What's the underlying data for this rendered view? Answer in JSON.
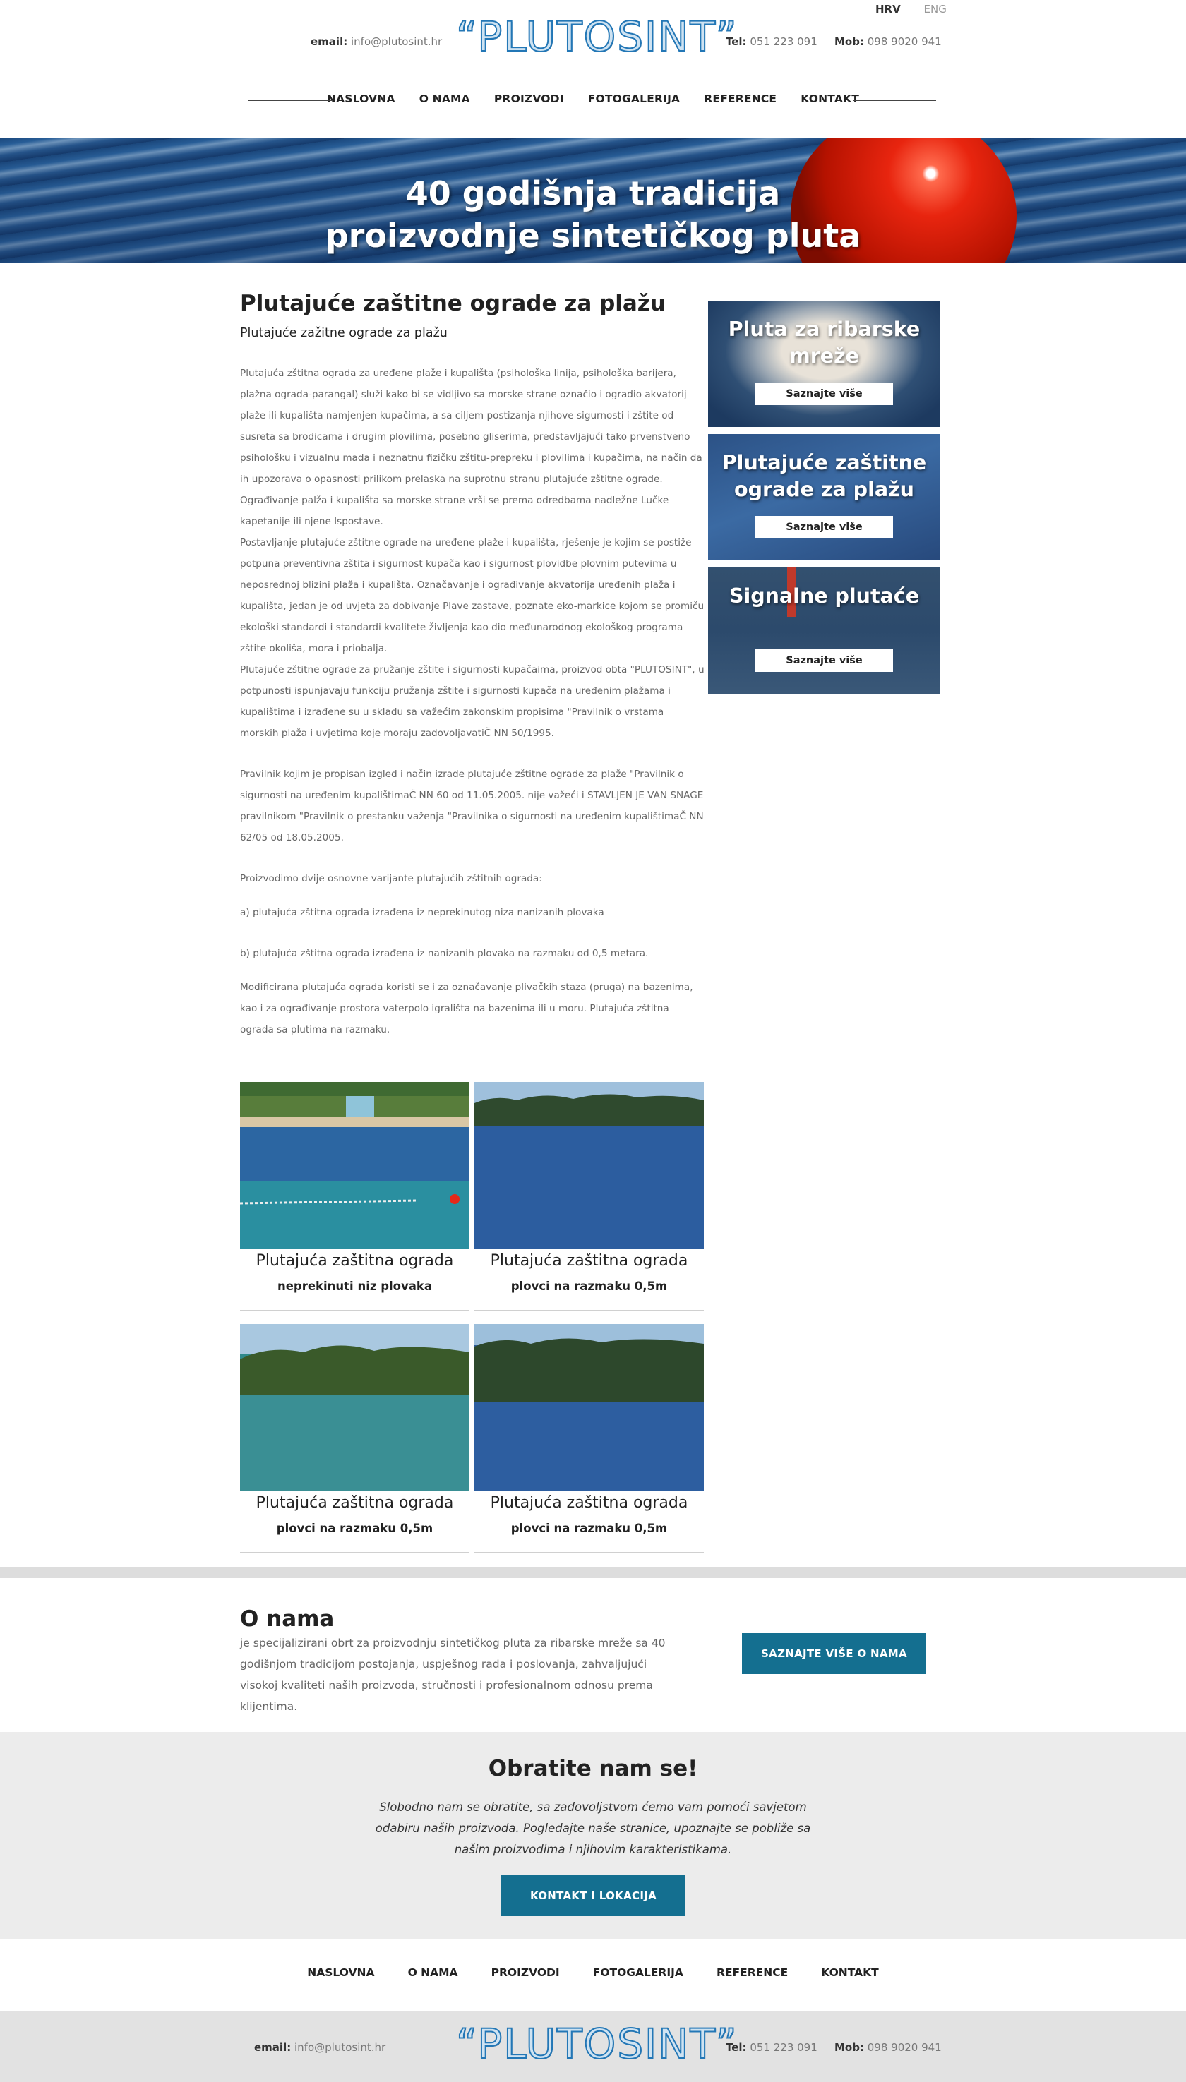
{
  "header": {
    "languages": [
      {
        "label": "HRV",
        "active": true
      },
      {
        "label": "ENG",
        "active": false
      }
    ],
    "email_label": "email:",
    "email": "info@plutosint.hr",
    "logo_text": "“PLUTOSINT”",
    "tel_label": "Tel:",
    "tel": "051 223 091",
    "mob_label": "Mob:",
    "mob": "098 9020 941"
  },
  "nav": {
    "items": [
      "NASLOVNA",
      "O NAMA",
      "PROIZVODI",
      "FOTOGALERIJA",
      "REFERENCE",
      "KONTAKT"
    ]
  },
  "hero": {
    "line1": "40 godišnja tradicija",
    "line2": "proizvodnje sintetičkog pluta"
  },
  "main": {
    "title": "Plutajuće zaštitne ograde za plažu",
    "subtitle": "Plutajuće zažitne ograde za plažu",
    "para1": "Plutajuća zštitna ograda za uređene plaže i kupališta (psihološka linija, psihološka barijera, plažna ograda-parangal) služi kako bi se vidljivo sa morske strane označio i ogradio akvatorij plaže ili kupališta namjenjen kupačima, a sa ciljem postizanja njihove sigurnosti i zštite od susreta sa brodicama i drugim plovilima, posebno gliserima, predstavljajući tako prvenstveno psihološku i vizualnu mada i neznatnu fizičku zštitu-prepreku i plovilima i kupačima, na način da ih upozorava o opasnosti prilikom prelaska na suprotnu stranu plutajuće zštitne ograde. Ograđivanje palža i kupališta sa morske strane vrši se prema odredbama nadležne Lučke kapetanije ili njene Ispostave.",
    "para2": "Postavljanje plutajuće zštitne ograde na uređene plaže i kupališta, rješenje je kojim se postiže potpuna preventivna zštita i sigurnost kupača kao i sigurnost plovidbe plovnim putevima u neposrednoj blizini plaža i kupališta. Označavanje i ograđivanje akvatorija uređenih plaža i kupališta, jedan je od uvjeta za dobivanje Plave zastave, poznate eko-markice kojom se promiču ekološki standardi i standardi kvalitete življenja kao dio međunarodnog ekološkog programa zštite okoliša, mora i priobalja.",
    "para3": "Plutajuće zštitne ograde za pružanje zštite i sigurnosti kupačaima, proizvod obta \"PLUTOSINT\", u potpunosti ispunjavaju funkciju pružanja zštite i sigurnosti kupača na uređenim plažama i kupalištima i izrađene su u skladu sa važećim zakonskim propisima \"Pravilnik o vrstama morskih plaža i uvjetima koje moraju zadovoljavatiČ NN 50/1995.",
    "para4": "Pravilnik kojim je propisan izgled i način izrade plutajuće zštitne ograde za plaže \"Pravilnik o sigurnosti na uređenim kupalištimaČ NN 60 od 11.05.2005. nije važeći i STAVLJEN JE VAN SNAGE pravilnikom \"Pravilnik o prestanku važenja \"Pravilnika o sigurnosti na uređenim kupalištimaČ NN 62/05 od 18.05.2005.",
    "para5": "Proizvodimo dvije osnovne varijante plutajućih zštitnih ograda:",
    "para6": "a) plutajuća zštitna ograda izrađena iz neprekinutog niza nanizanih plovaka",
    "para7": "b) plutajuća zštitna ograda izrađena iz nanizanih plovaka na razmaku od 0,5 metara.",
    "para8": "Modificirana plutajuća ograda koristi se i za označavanje plivačkih staza (pruga) na bazenima, kao i za ograđivanje prostora vaterpolo igrališta na bazenima ili u moru. Plutajuća zštitna ograda sa plutima na razmaku."
  },
  "gallery": [
    {
      "caption": "Plutajuća zaštitna ograda",
      "subcaption": "neprekinuti niz plovaka"
    },
    {
      "caption": "Plutajuća zaštitna ograda",
      "subcaption": "plovci na razmaku 0,5m"
    },
    {
      "caption": "Plutajuća zaštitna ograda",
      "subcaption": "plovci na razmaku 0,5m"
    },
    {
      "caption": "Plutajuća zaštitna ograda",
      "subcaption": "plovci na razmaku 0,5m"
    }
  ],
  "sidebar": [
    {
      "title": "Pluta za ribarske mreže",
      "button": "Saznajte više"
    },
    {
      "title": "Plutajuće zaštitne ograde za plažu",
      "button": "Saznajte više"
    },
    {
      "title": "Signalne plutaće",
      "button": "Saznajte više"
    }
  ],
  "about": {
    "title": "O nama",
    "text": "je specijalizirani obrt za proizvodnju sintetičkog pluta za ribarske mreže sa 40 godišnjom tradicijom postojanja, uspješnog rada i poslovanja, zahvaljujući visokoj kvaliteti naših proizvoda, stručnosti i profesionalnom odnosu prema klijentima.",
    "button": "SAZNAJTE VIŠE O NAMA"
  },
  "contact": {
    "title": "Obratite nam se!",
    "text": "Slobodno nam se obratite, sa zadovoljstvom ćemo vam pomoći savjetom odabiru naših proizvoda. Pogledajte naše stranice, upoznajte se pobliže sa našim proizvodima i njihovim karakteristikama.",
    "button": "KONTAKT I LOKACIJA"
  },
  "footer_nav": {
    "items": [
      "NASLOVNA",
      "O NAMA",
      "PROIZVODI",
      "FOTOGALERIJA",
      "REFERENCE",
      "KONTAKT"
    ]
  },
  "footer": {
    "email_label": "email:",
    "email": "info@plutosint.hr",
    "logo_text": "“PLUTOSINT”",
    "tel_label": "Tel:",
    "tel": "051 223 091",
    "mob_label": "Mob:",
    "mob": "098 9020 941"
  },
  "colors": {
    "accent": "#146f90",
    "logo_blue": "#2377b6",
    "footer_bg": "#e2e2e2",
    "contact_bg": "#ececec"
  }
}
